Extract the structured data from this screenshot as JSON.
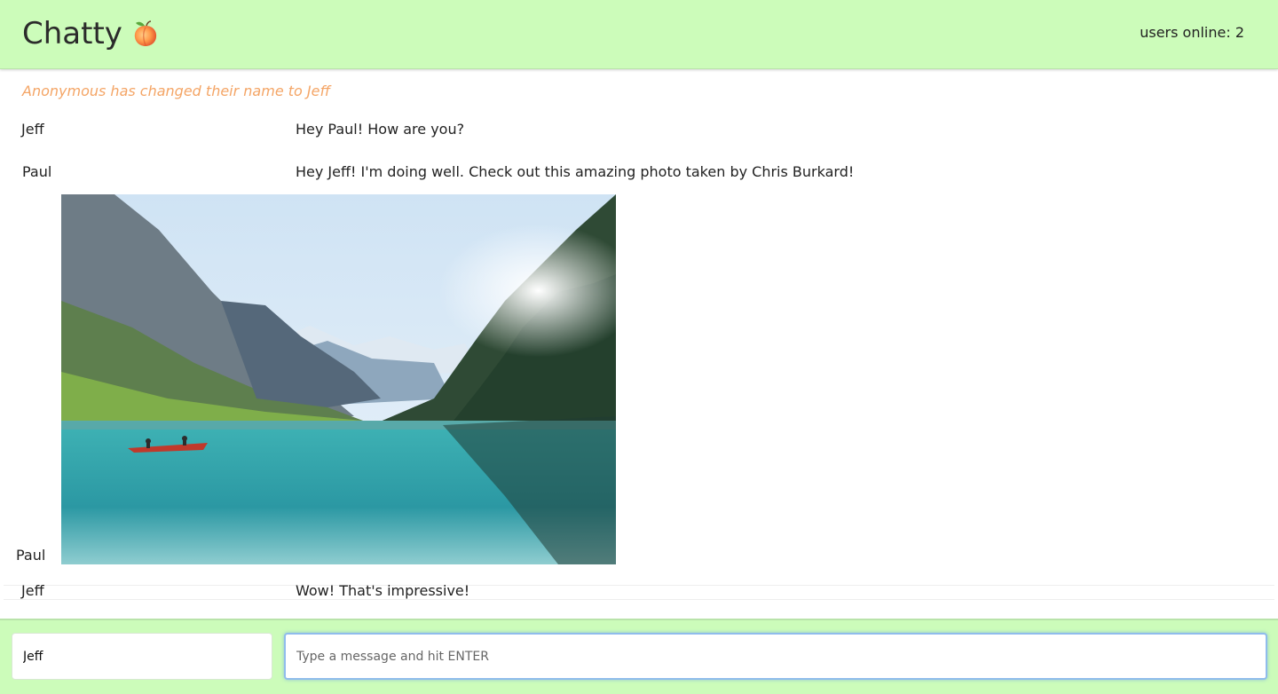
{
  "header": {
    "title": "Chatty",
    "logo_icon": "peach-emoji",
    "users_online": "users online: 2",
    "background": "#ccfcba"
  },
  "notification": {
    "text": "Anonymous has changed their name to Jeff",
    "color": "#f4a566"
  },
  "messages": [
    {
      "user": "Jeff",
      "content": "Hey Paul! How are you?"
    },
    {
      "user": "Paul",
      "content": "Hey Jeff! I'm doing well. Check out this amazing photo taken by Chris Burkard!"
    },
    {
      "user": "Paul",
      "content_type": "image",
      "image": "mountain-lake-canoe-photo"
    },
    {
      "user": "Jeff",
      "content": "Wow! That's impressive!"
    }
  ],
  "composer": {
    "username_value": "Jeff",
    "message_placeholder": "Type a message and hit ENTER"
  }
}
